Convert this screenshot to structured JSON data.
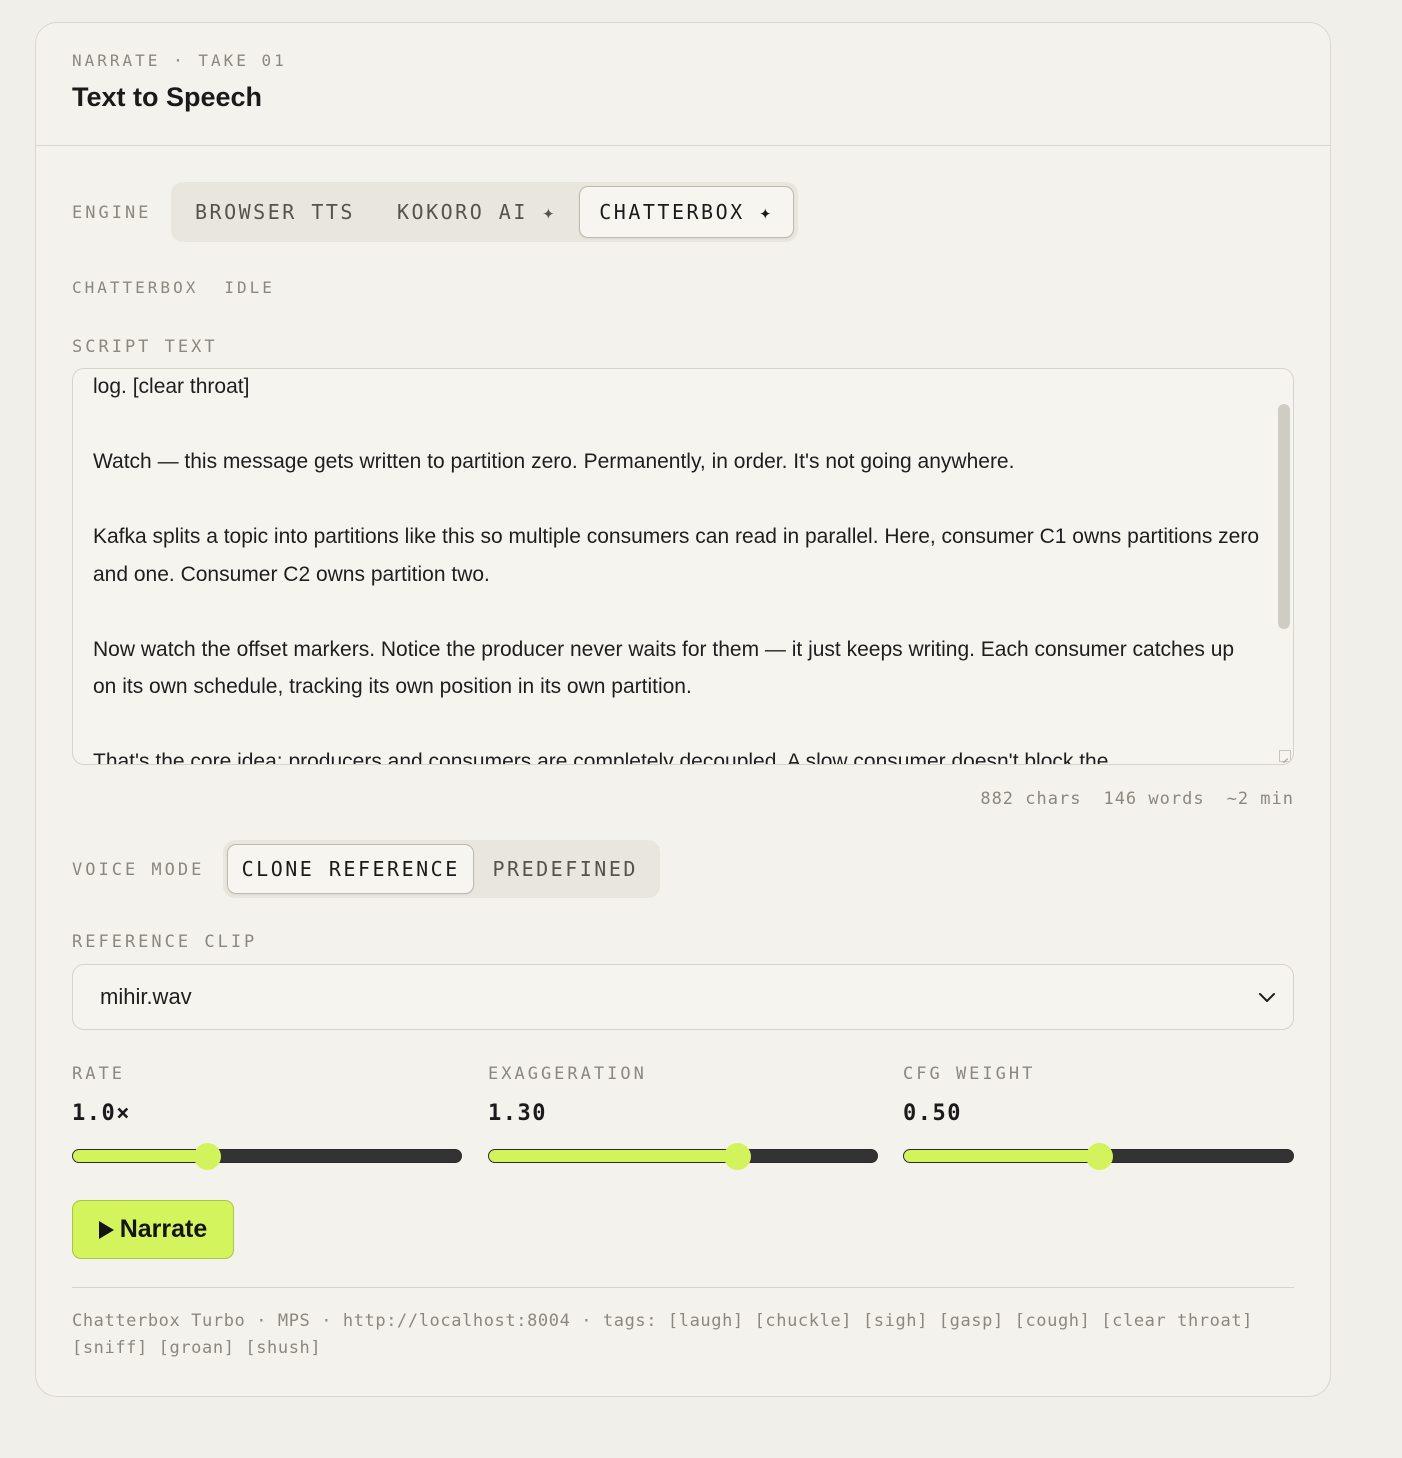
{
  "header": {
    "eyebrow": "NARRATE · TAKE 01",
    "title": "Text to Speech"
  },
  "engine": {
    "label": "ENGINE",
    "options": [
      "BROWSER TTS",
      "KOKORO AI ✦",
      "CHATTERBOX ✦"
    ],
    "selected": "CHATTERBOX ✦"
  },
  "status": {
    "engine_name": "CHATTERBOX",
    "state": "IDLE"
  },
  "script": {
    "label": "SCRIPT TEXT",
    "visible_text": "log. [clear throat]\n\nWatch — this message gets written to partition zero. Permanently, in order. It's not going anywhere.\n\nKafka splits a topic into partitions like this so multiple consumers can read in parallel. Here, consumer C1 owns partitions zero and one. Consumer C2 owns partition two.\n\nNow watch the offset markers. Notice the producer never waits for them — it just keeps writing. Each consumer catches up on its own schedule, tracking its own position in its own partition.\n\nThat's the core idea: producers and consumers are completely decoupled. A slow consumer doesn't block the",
    "chars": "882 chars",
    "words": "146 words",
    "duration": "~2 min"
  },
  "voice_mode": {
    "label": "VOICE MODE",
    "options": [
      "CLONE REFERENCE",
      "PREDEFINED"
    ],
    "selected": "CLONE REFERENCE"
  },
  "reference_clip": {
    "label": "REFERENCE CLIP",
    "value": "mihir.wav"
  },
  "sliders": {
    "rate": {
      "label": "RATE",
      "display": "1.0×",
      "fraction": 0.345
    },
    "exaggeration": {
      "label": "EXAGGERATION",
      "display": "1.30",
      "fraction": 0.64
    },
    "cfg_weight": {
      "label": "CFG WEIGHT",
      "display": "0.50",
      "fraction": 0.5
    }
  },
  "narrate_button": {
    "label": "Narrate",
    "icon": "play-icon"
  },
  "footer": {
    "text": "Chatterbox Turbo · MPS · http://localhost:8004 · tags: [laugh] [chuckle] [sigh] [gasp] [cough] [clear throat] [sniff] [groan] [shush]"
  },
  "colors": {
    "accent": "#d3f35c",
    "track": "#333333",
    "background": "#f4f2ec"
  }
}
